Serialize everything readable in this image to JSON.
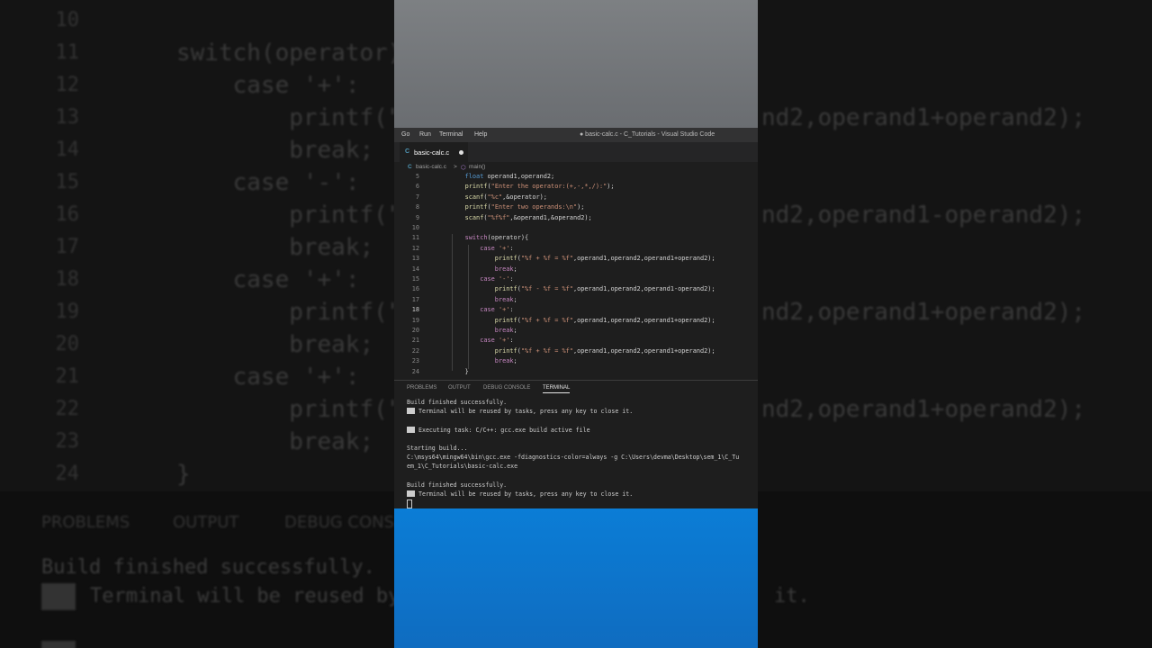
{
  "window_title": "● basic-calc.c - C_Tutorials - Visual Studio Code",
  "menu": [
    "Go",
    "Run",
    "Terminal",
    "Help"
  ],
  "tab": {
    "icon": "C",
    "label": "basic-calc.c"
  },
  "breadcrumb": {
    "file_icon": "C",
    "file": "basic-calc.c",
    "sep": ">",
    "symbol": "main()"
  },
  "editor_lines": [
    {
      "n": "5",
      "text": "    float operand1,operand2;"
    },
    {
      "n": "6",
      "text": "    printf(\"Enter the operator:(+,-,*,/):\");"
    },
    {
      "n": "7",
      "text": "    scanf(\"%c\",&operator);"
    },
    {
      "n": "8",
      "text": "    printf(\"Enter two operands:\\n\");"
    },
    {
      "n": "9",
      "text": "    scanf(\"%f%f\",&operand1,&operand2);"
    },
    {
      "n": "10",
      "text": ""
    },
    {
      "n": "11",
      "text": "    switch(operator){"
    },
    {
      "n": "12",
      "text": "        case '+':"
    },
    {
      "n": "13",
      "text": "            printf(\"%f + %f = %f\",operand1,operand2,operand1+operand2);"
    },
    {
      "n": "14",
      "text": "            break;"
    },
    {
      "n": "15",
      "text": "        case '-':"
    },
    {
      "n": "16",
      "text": "            printf(\"%f - %f = %f\",operand1,operand2,operand1-operand2);"
    },
    {
      "n": "17",
      "text": "            break;"
    },
    {
      "n": "18",
      "text": "        case '+':"
    },
    {
      "n": "19",
      "text": "            printf(\"%f + %f = %f\",operand1,operand2,operand1+operand2);"
    },
    {
      "n": "20",
      "text": "            break;"
    },
    {
      "n": "21",
      "text": "        case '+':"
    },
    {
      "n": "22",
      "text": "            printf(\"%f + %f = %f\",operand1,operand2,operand1+operand2);"
    },
    {
      "n": "23",
      "text": "            break;"
    },
    {
      "n": "24",
      "text": "    }"
    }
  ],
  "panel_tabs": [
    "PROBLEMS",
    "OUTPUT",
    "DEBUG CONSOLE",
    "TERMINAL"
  ],
  "active_panel_tab": "TERMINAL",
  "terminal": {
    "l1": "Build finished successfully.",
    "l2": "Terminal will be reused by tasks, press any key to close it.",
    "l3": "Executing task: C/C++: gcc.exe build active file",
    "l4": "Starting build...",
    "l5": "C:\\msys64\\mingw64\\bin\\gcc.exe -fdiagnostics-color=always -g C:\\Users\\devma\\Desktop\\sem_1\\C_Tu",
    "l6": "em_1\\C_Tutorials\\basic-calc.exe",
    "l7": "Build finished successfully.",
    "l8": "Terminal will be reused by tasks, press any key to close it."
  },
  "background": {
    "lines": [
      {
        "n": "10",
        "text": ""
      },
      {
        "n": "11",
        "text": "switch(operator){"
      },
      {
        "n": "12",
        "text": "    case '+':"
      },
      {
        "n": "13",
        "text": "        printf(\"%"
      },
      {
        "n": "14",
        "text": "        break;"
      },
      {
        "n": "15",
        "text": "    case '-':"
      },
      {
        "n": "16",
        "text": "        printf(\"%"
      },
      {
        "n": "17",
        "text": "        break;"
      },
      {
        "n": "18",
        "text": "    case '+':"
      },
      {
        "n": "19",
        "text": "        printf(\"%"
      },
      {
        "n": "20",
        "text": "        break;"
      },
      {
        "n": "21",
        "text": "    case '+':"
      },
      {
        "n": "22",
        "text": "        printf(\"%"
      },
      {
        "n": "23",
        "text": "        break;"
      },
      {
        "n": "24",
        "text": "}"
      }
    ],
    "right_texts": [
      "nd2,operand1+operand2);",
      "nd2,operand1-operand2);",
      "nd2,operand1+operand2);",
      "nd2,operand1+operand2);"
    ],
    "panel_tabs": [
      "PROBLEMS",
      "OUTPUT",
      "DEBUG CONS"
    ],
    "p1": "Build finished successfully.",
    "p2": "Terminal will be reused by",
    "p2_end": "it."
  }
}
